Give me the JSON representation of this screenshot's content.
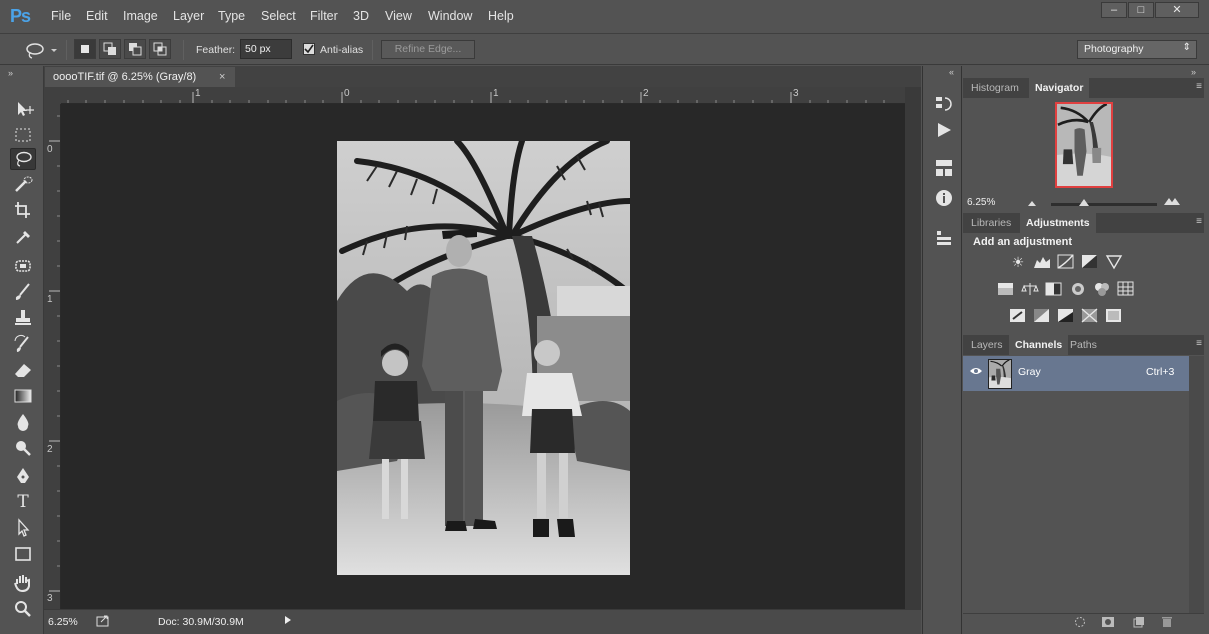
{
  "app": {
    "logo": "Ps"
  },
  "menu": [
    "File",
    "Edit",
    "Image",
    "Layer",
    "Type",
    "Select",
    "Filter",
    "3D",
    "View",
    "Window",
    "Help"
  ],
  "window_controls": {
    "minimize": "‒",
    "maximize": "□",
    "close": "✕"
  },
  "options": {
    "feather_label": "Feather:",
    "feather_value": "50 px",
    "antialias_label": "Anti-alias",
    "antialias_checked": true,
    "refine_edge": "Refine Edge...",
    "workspace": "Photography"
  },
  "document": {
    "tab_title": "ooooTIF.tif @ 6.25% (Gray/8)",
    "close": "×",
    "ruler_h": [
      "1",
      "0",
      "1",
      "2",
      "3"
    ],
    "ruler_v": [
      "0",
      "1",
      "2",
      "3"
    ]
  },
  "status": {
    "zoom": "6.25%",
    "doc_size": "Doc: 30.9M/30.9M"
  },
  "tools": [
    "move-tool",
    "marquee-tool",
    "lasso-tool",
    "quick-selection-tool",
    "crop-tool",
    "eyedropper-tool",
    "spot-healing-tool",
    "brush-tool",
    "clone-stamp-tool",
    "history-brush-tool",
    "eraser-tool",
    "gradient-tool",
    "blur-tool",
    "dodge-tool",
    "pen-tool",
    "type-tool",
    "path-selection-tool",
    "rectangle-tool",
    "hand-tool",
    "zoom-tool"
  ],
  "tool_type_glyph": "T",
  "panels": {
    "top_tabs": [
      "Histogram",
      "Navigator"
    ],
    "navigator_zoom": "6.25%",
    "mid_tabs": [
      "Libraries",
      "Adjustments"
    ],
    "adjustments_title": "Add an adjustment",
    "bottom_tabs": [
      "Layers",
      "Channels",
      "Paths"
    ],
    "channel": {
      "name": "Gray",
      "shortcut": "Ctrl+3"
    }
  },
  "accent_color": "#687790",
  "navigator_frame_color": "#e04040"
}
